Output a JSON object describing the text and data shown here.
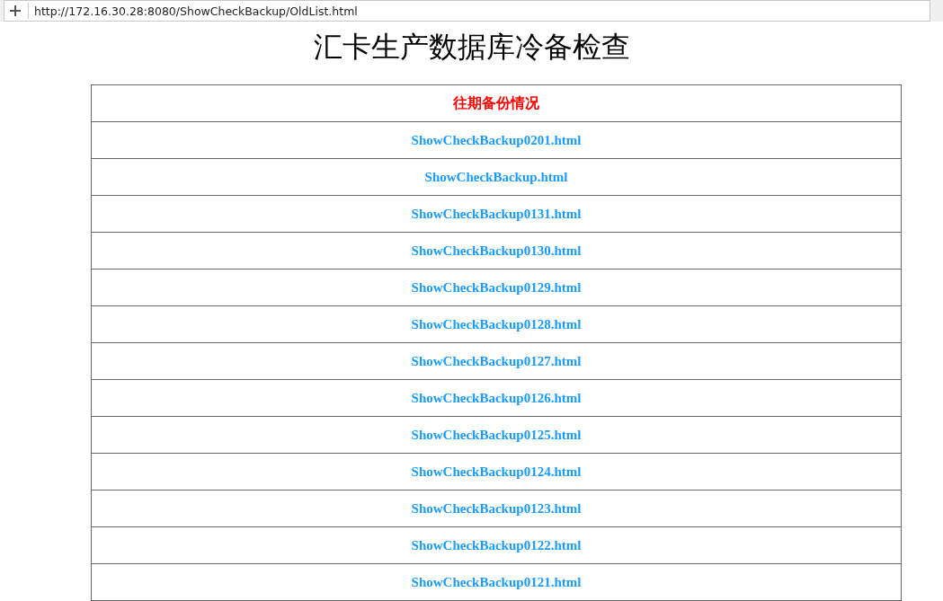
{
  "address_bar": {
    "url": "http://172.16.30.28:8080/ShowCheckBackup/OldList.html"
  },
  "page_title": "汇卡生产数据库冷备检查",
  "table": {
    "header": "往期备份情况",
    "rows": [
      "ShowCheckBackup0201.html",
      "ShowCheckBackup.html",
      "ShowCheckBackup0131.html",
      "ShowCheckBackup0130.html",
      "ShowCheckBackup0129.html",
      "ShowCheckBackup0128.html",
      "ShowCheckBackup0127.html",
      "ShowCheckBackup0126.html",
      "ShowCheckBackup0125.html",
      "ShowCheckBackup0124.html",
      "ShowCheckBackup0123.html",
      "ShowCheckBackup0122.html",
      "ShowCheckBackup0121.html"
    ]
  }
}
